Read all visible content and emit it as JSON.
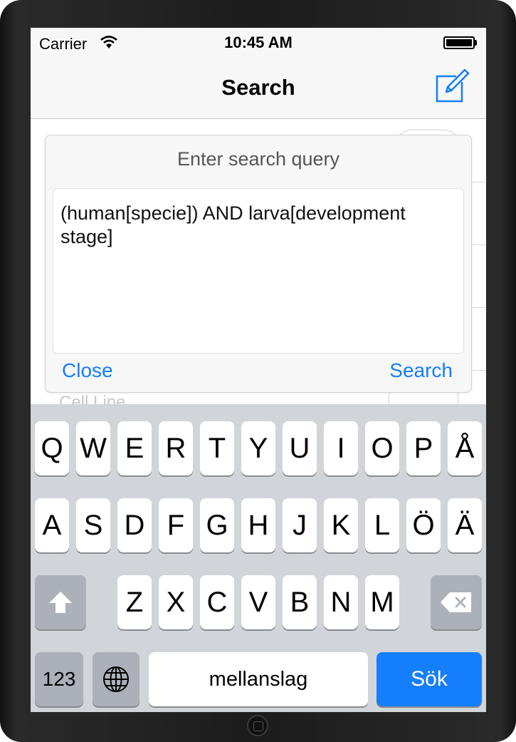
{
  "status_bar": {
    "carrier": "Carrier",
    "time": "10:45 AM"
  },
  "nav": {
    "title": "Search",
    "compose_icon": "compose-icon"
  },
  "background": {
    "partial_label": "Cell Line"
  },
  "dialog": {
    "title": "Enter search query",
    "query": "(human[specie]) AND larva[development stage]",
    "close_label": "Close",
    "search_label": "Search"
  },
  "keyboard": {
    "rows": [
      [
        "Q",
        "W",
        "E",
        "R",
        "T",
        "Y",
        "U",
        "I",
        "O",
        "P",
        "Å"
      ],
      [
        "A",
        "S",
        "D",
        "F",
        "G",
        "H",
        "J",
        "K",
        "L",
        "Ö",
        "Ä"
      ],
      [
        "Z",
        "X",
        "C",
        "V",
        "B",
        "N",
        "M"
      ]
    ],
    "shift_icon": "shift-icon",
    "backspace_icon": "backspace-icon",
    "globe_icon": "globe-icon",
    "numbers_label": "123",
    "space_label": "mellanslag",
    "return_label": "Sök"
  },
  "colors": {
    "accent": "#157efb",
    "keyboard_bg": "#d1d4d9",
    "special_key": "#acb1b9"
  }
}
